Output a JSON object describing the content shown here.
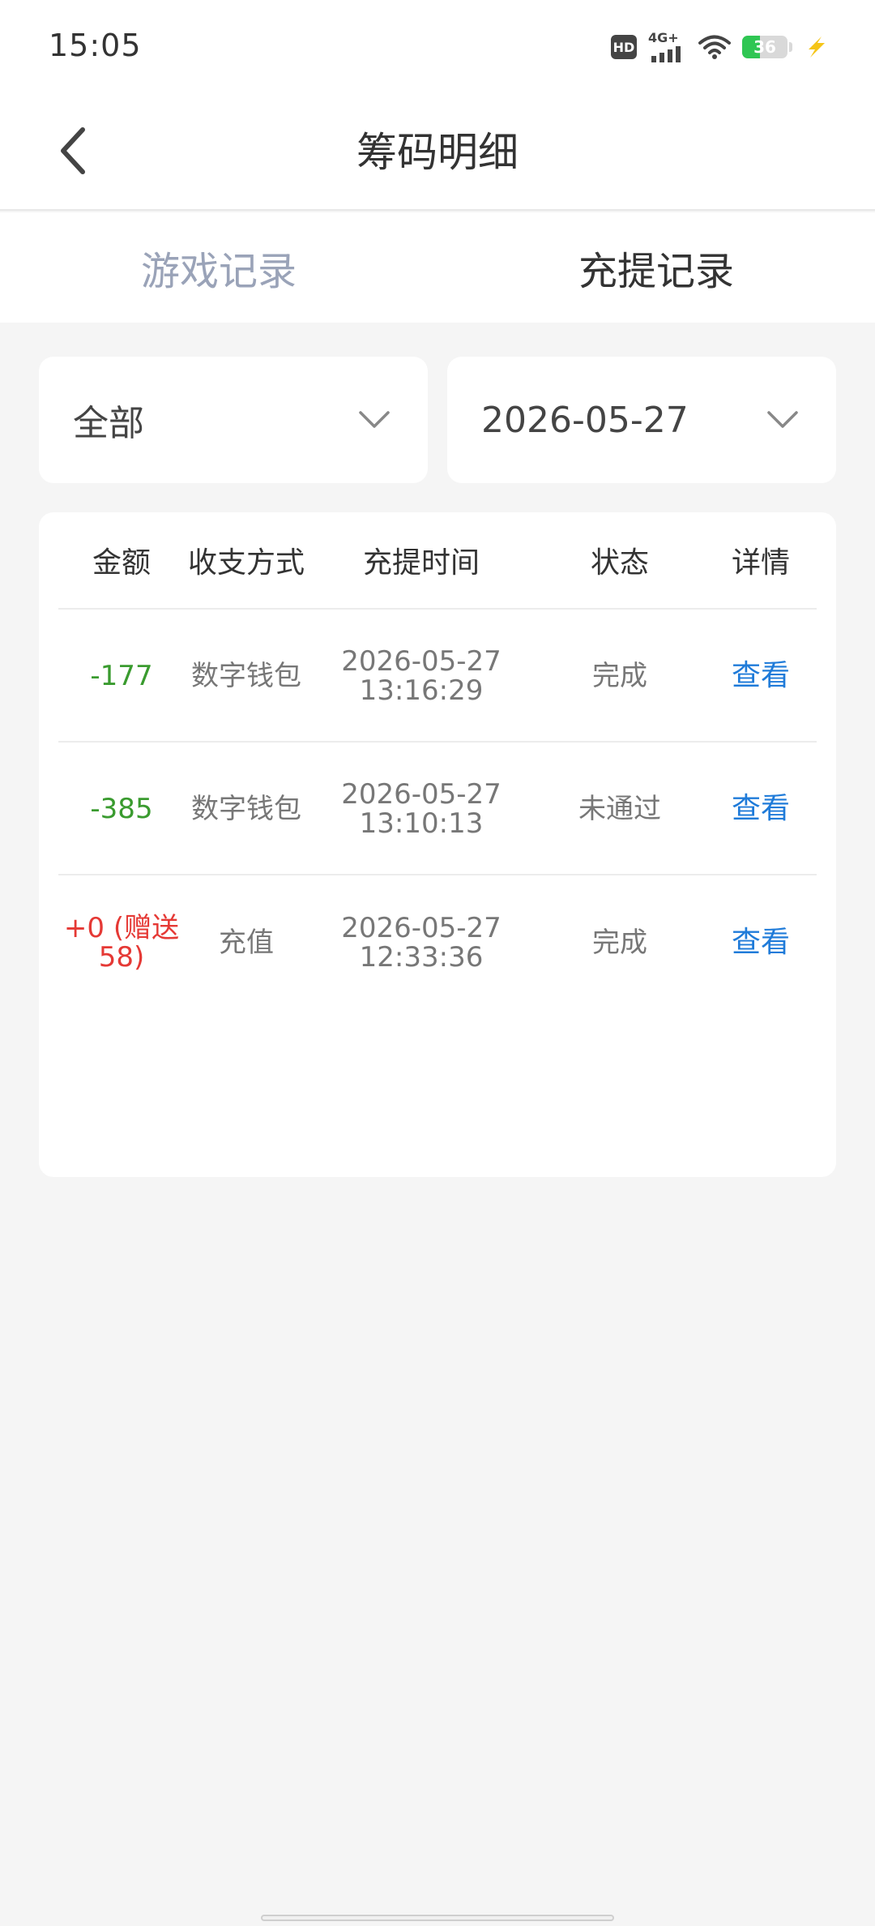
{
  "status_bar": {
    "time": "15:05",
    "hd_label": "HD",
    "network_label": "4G+",
    "battery_level": "36",
    "icons": [
      "hd-icon",
      "signal-icon",
      "wifi-icon",
      "battery-icon",
      "charging-icon"
    ]
  },
  "header": {
    "title": "筹码明细",
    "back_icon": "chevron-left-icon"
  },
  "tabs": [
    {
      "label": "游戏记录",
      "active": false
    },
    {
      "label": "充提记录",
      "active": true
    }
  ],
  "filters": {
    "type_value": "全部",
    "date_value": "2026-05-27",
    "dropdown_icon": "chevron-down-icon"
  },
  "table": {
    "columns": [
      "金额",
      "收支方式",
      "充提时间",
      "状态",
      "详情"
    ],
    "rows": [
      {
        "amount": "-177",
        "method": "数字钱包",
        "date": "2026-05-27",
        "time": "13:16:29",
        "status": "完成",
        "detail": "查看"
      },
      {
        "amount": "-385",
        "method": "数字钱包",
        "date": "2026-05-27",
        "time": "13:10:13",
        "status": "未通过",
        "detail": "查看"
      },
      {
        "amount_line1": "+0 (赠送",
        "amount_line2": "58)",
        "method": "充值",
        "date": "2026-05-27",
        "time": "12:33:36",
        "status": "完成",
        "detail": "查看"
      }
    ]
  },
  "colors": {
    "negative_amount": "#3a9b2f",
    "positive_amount": "#e53935",
    "link": "#1f7bd9",
    "inactive_tab": "#9aa3b8",
    "battery_fill": "#2fc653",
    "charging": "#f5c518"
  }
}
